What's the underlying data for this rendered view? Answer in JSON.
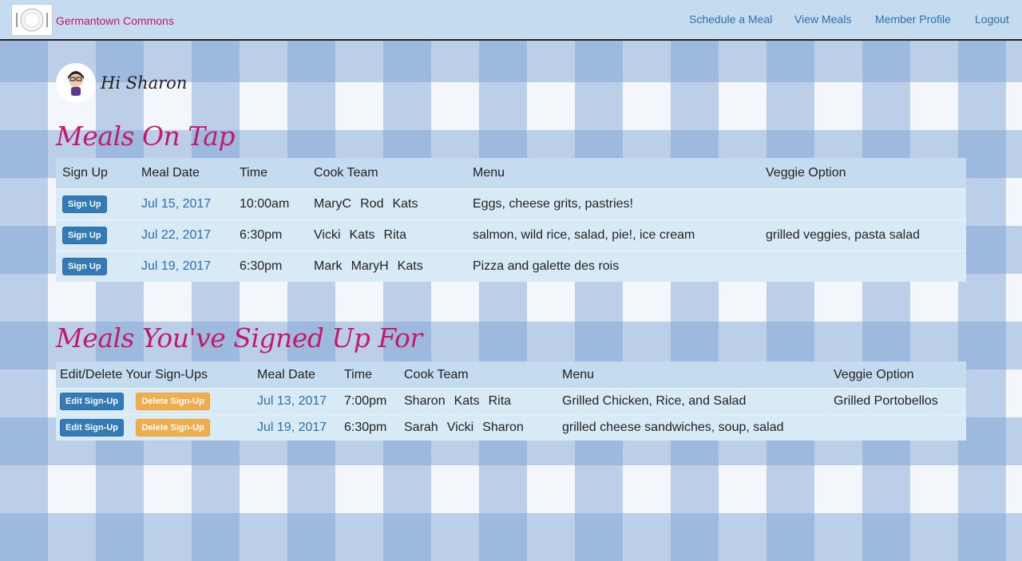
{
  "nav": {
    "brand": "Germantown Commons",
    "links": [
      "Schedule a Meal",
      "View Meals",
      "Member Profile",
      "Logout"
    ]
  },
  "greeting": "Hi Sharon",
  "on_tap": {
    "title": "Meals On Tap",
    "headers": [
      "Sign Up",
      "Meal Date",
      "Time",
      "Cook Team",
      "Menu",
      "Veggie Option"
    ],
    "rows": [
      {
        "button": "Sign Up",
        "date": "Jul 15, 2017",
        "time": "10:00am",
        "cooks": [
          "MaryC",
          "Rod",
          "Kats"
        ],
        "menu": "Eggs, cheese grits, pastries!",
        "veggie": ""
      },
      {
        "button": "Sign Up",
        "date": "Jul 22, 2017",
        "time": "6:30pm",
        "cooks": [
          "Vicki",
          "Kats",
          "Rita"
        ],
        "menu": "salmon, wild rice, salad, pie!, ice cream",
        "veggie": "grilled veggies, pasta salad"
      },
      {
        "button": "Sign Up",
        "date": "Jul 19, 2017",
        "time": "6:30pm",
        "cooks": [
          "Mark",
          "MaryH",
          "Kats"
        ],
        "menu": "Pizza and galette des rois",
        "veggie": ""
      }
    ]
  },
  "signed_up": {
    "title": "Meals You've Signed Up For",
    "headers": [
      "Edit/Delete Your Sign-Ups",
      "Meal Date",
      "Time",
      "Cook Team",
      "Menu",
      "Veggie Option"
    ],
    "rows": [
      {
        "edit": "Edit Sign-Up",
        "delete": "Delete Sign-Up",
        "date": "Jul 13, 2017",
        "time": "7:00pm",
        "cooks": [
          "Sharon",
          "Kats",
          "Rita"
        ],
        "menu": "Grilled Chicken, Rice, and Salad",
        "veggie": "Grilled Portobellos"
      },
      {
        "edit": "Edit Sign-Up",
        "delete": "Delete Sign-Up",
        "date": "Jul 19, 2017",
        "time": "6:30pm",
        "cooks": [
          "Sarah",
          "Vicki",
          "Sharon"
        ],
        "menu": "grilled cheese sandwiches, soup, salad",
        "veggie": ""
      }
    ]
  },
  "colors": {
    "brand": "#c0185f",
    "title": "#c41a6e",
    "link": "#2a6fb3",
    "primary_button": "#337ab7",
    "warning_button": "#f0ad4e"
  },
  "icons": {
    "logo": "dinner-plate-logo-icon",
    "avatar": "user-avatar-icon"
  }
}
